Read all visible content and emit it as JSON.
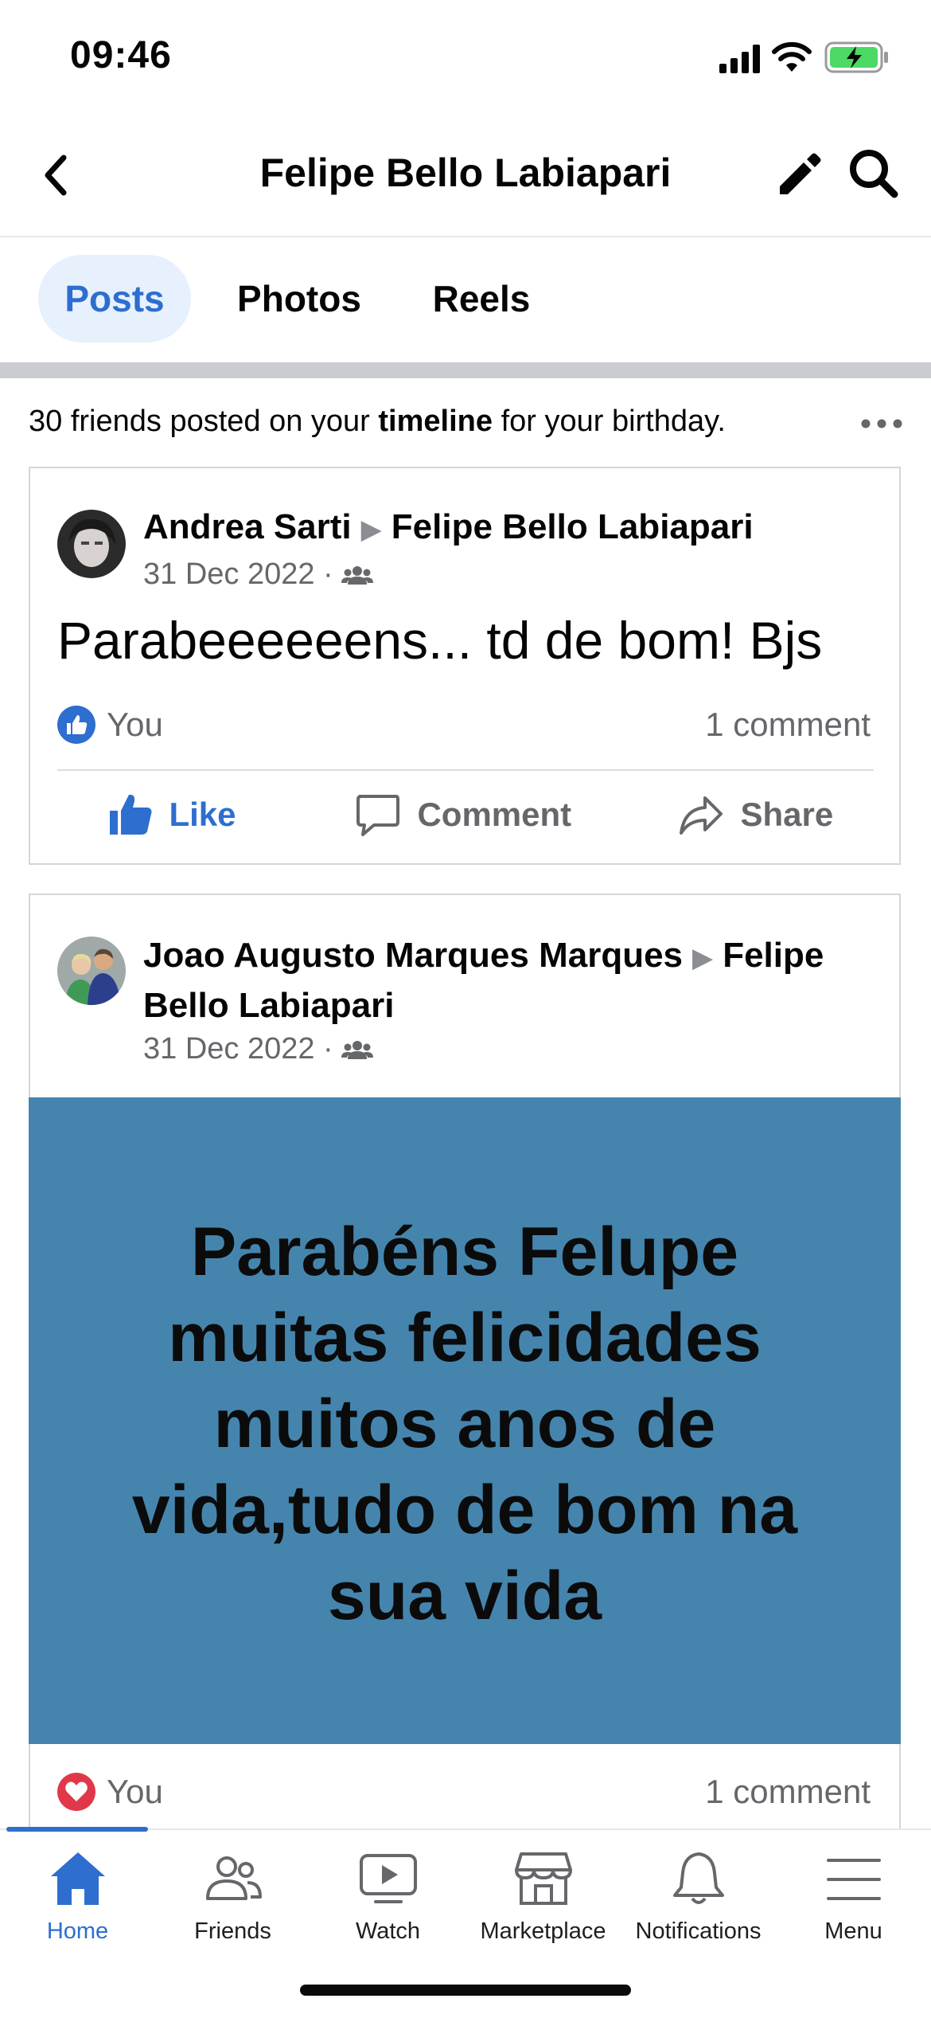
{
  "status_bar": {
    "time": "09:46"
  },
  "header": {
    "title": "Felipe Bello Labiapari"
  },
  "tabs": [
    {
      "label": "Posts",
      "active": true
    },
    {
      "label": "Photos",
      "active": false
    },
    {
      "label": "Reels",
      "active": false
    }
  ],
  "birthday_notice": {
    "prefix": "30 friends posted on your ",
    "bold": "timeline",
    "suffix": " for your birthday."
  },
  "posts": [
    {
      "author": "Andrea Sarti",
      "target": "Felipe Bello Labiapari",
      "date": "31 Dec 2022",
      "text": "Parabeeeeeens... td de bom! Bjs",
      "reaction_label": "You",
      "comments": "1 comment",
      "actions": {
        "like": "Like",
        "comment": "Comment",
        "share": "Share"
      }
    },
    {
      "author": "Joao Augusto Marques Marques",
      "target_first": "Felipe",
      "target_rest": "Bello Labiapari",
      "date": "31 Dec 2022",
      "banner_lines": [
        "Parabéns Felupe",
        "muitas felicidades",
        "muitos anos de",
        "vida,tudo de bom na",
        "sua vida"
      ],
      "banner_color": "#4585ad",
      "reaction_label": "You",
      "comments": "1 comment"
    }
  ],
  "bottom_nav": [
    {
      "label": "Home",
      "icon": "home-icon",
      "active": true
    },
    {
      "label": "Friends",
      "icon": "friends-icon",
      "active": false
    },
    {
      "label": "Watch",
      "icon": "watch-icon",
      "active": false
    },
    {
      "label": "Marketplace",
      "icon": "marketplace-icon",
      "active": false
    },
    {
      "label": "Notifications",
      "icon": "bell-icon",
      "active": false
    },
    {
      "label": "Menu",
      "icon": "menu-icon",
      "active": false
    }
  ],
  "colors": {
    "accent": "#2d6ecf",
    "love": "#e0384a"
  }
}
